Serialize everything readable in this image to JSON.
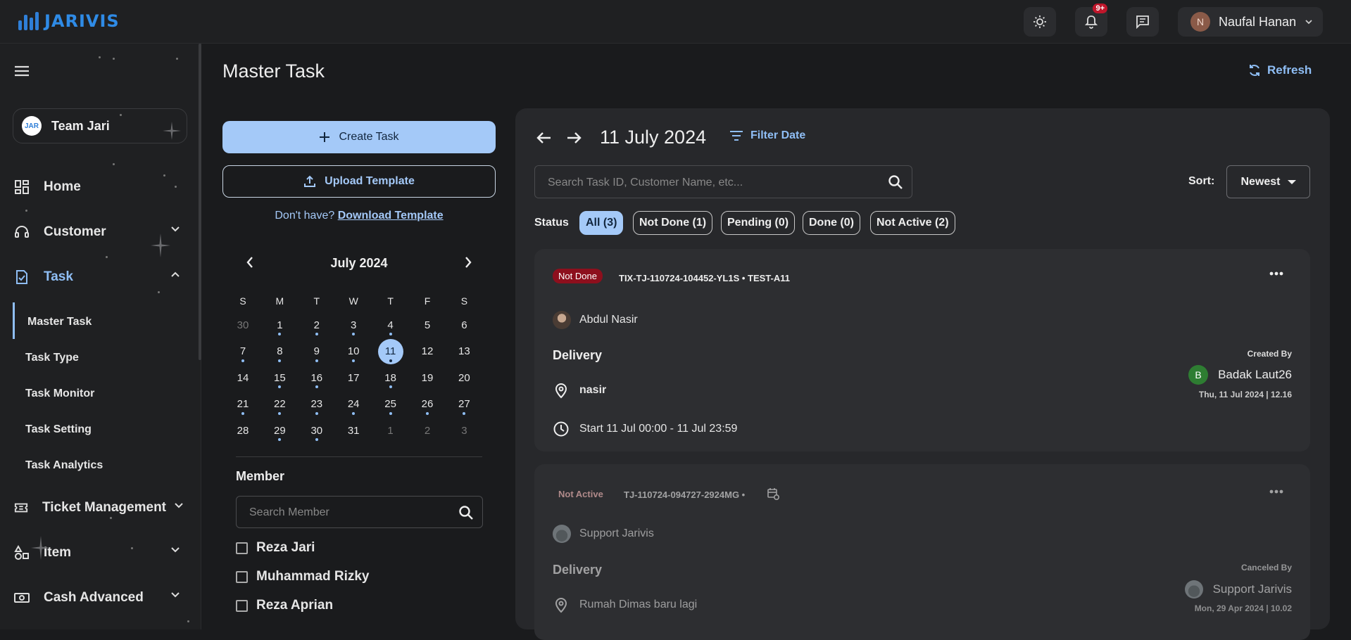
{
  "app": {
    "logo_text": "JARIVIS",
    "brand_color": "#2f8be6"
  },
  "header": {
    "notifications_badge": "9+",
    "user": {
      "initial": "N",
      "name": "Naufal Hanan"
    }
  },
  "sidebar": {
    "team": {
      "logo_text": "JAR",
      "name": "Team Jari"
    },
    "items": [
      {
        "label": "Home",
        "icon": "dashboard-icon"
      },
      {
        "label": "Customer",
        "icon": "headset-icon"
      },
      {
        "label": "Task",
        "icon": "task-check-icon"
      },
      {
        "label": "Ticket Management",
        "icon": "ticket-icon"
      },
      {
        "label": "Item",
        "icon": "shapes-icon"
      },
      {
        "label": "Cash Advanced",
        "icon": "money-icon"
      }
    ],
    "task_sub": [
      "Master Task",
      "Task Type",
      "Task Monitor",
      "Task Setting",
      "Task Analytics"
    ]
  },
  "page": {
    "title": "Master Task",
    "refresh_label": "Refresh"
  },
  "left": {
    "create_label": "Create Task",
    "upload_label": "Upload Template",
    "dont_have": "Don't have?",
    "download_link": "Download Template",
    "calendar": {
      "title": "July 2024",
      "dow": [
        "S",
        "M",
        "T",
        "W",
        "T",
        "F",
        "S"
      ],
      "weeks": [
        [
          "30",
          "1",
          "2",
          "3",
          "4",
          "5",
          "6"
        ],
        [
          "7",
          "8",
          "9",
          "10",
          "11",
          "12",
          "13"
        ],
        [
          "14",
          "15",
          "16",
          "17",
          "18",
          "19",
          "20"
        ],
        [
          "21",
          "22",
          "23",
          "24",
          "25",
          "26",
          "27"
        ],
        [
          "28",
          "29",
          "30",
          "31",
          "1",
          "2",
          "3"
        ]
      ],
      "selected": "11",
      "dotted": [
        "1",
        "2",
        "3",
        "4",
        "7",
        "8",
        "9",
        "10",
        "11",
        "15",
        "16",
        "18",
        "21",
        "22",
        "23",
        "24",
        "25",
        "26",
        "27",
        "29",
        "30"
      ]
    },
    "member_title": "Member",
    "member_search_placeholder": "Search Member",
    "members": [
      "Reza Jari",
      "Muhammad Rizky",
      "Reza Aprian"
    ]
  },
  "main": {
    "date": "11 July 2024",
    "filter_label": "Filter Date",
    "search_placeholder": "Search Task ID, Customer Name, etc...",
    "sort_label": "Sort:",
    "sort_value": "Newest",
    "status_label": "Status",
    "chips": [
      "All (3)",
      "Not Done (1)",
      "Pending (0)",
      "Done (0)",
      "Not Active (2)"
    ],
    "cards": [
      {
        "status": "Not Done",
        "ticket": "TIX-TJ-110724-104452-YL1S • TEST-A11",
        "customer": "Abdul Nasir",
        "type": "Delivery",
        "location": "nasir",
        "time": "Start 11 Jul 00:00 - 11 Jul 23:59",
        "by_label": "Created By",
        "by_initial": "B",
        "by_name": "Badak Laut26",
        "by_date": "Thu, 11 Jul 2024 | 12.16"
      },
      {
        "status": "Not Active",
        "ticket": "TJ-110724-094727-2924MG •",
        "customer": "Support Jarivis",
        "type": "Delivery",
        "location": "Rumah Dimas baru lagi",
        "by_label": "Canceled By",
        "by_name": "Support Jarivis",
        "by_date": "Mon, 29 Apr 2024 | 10.02"
      }
    ]
  }
}
